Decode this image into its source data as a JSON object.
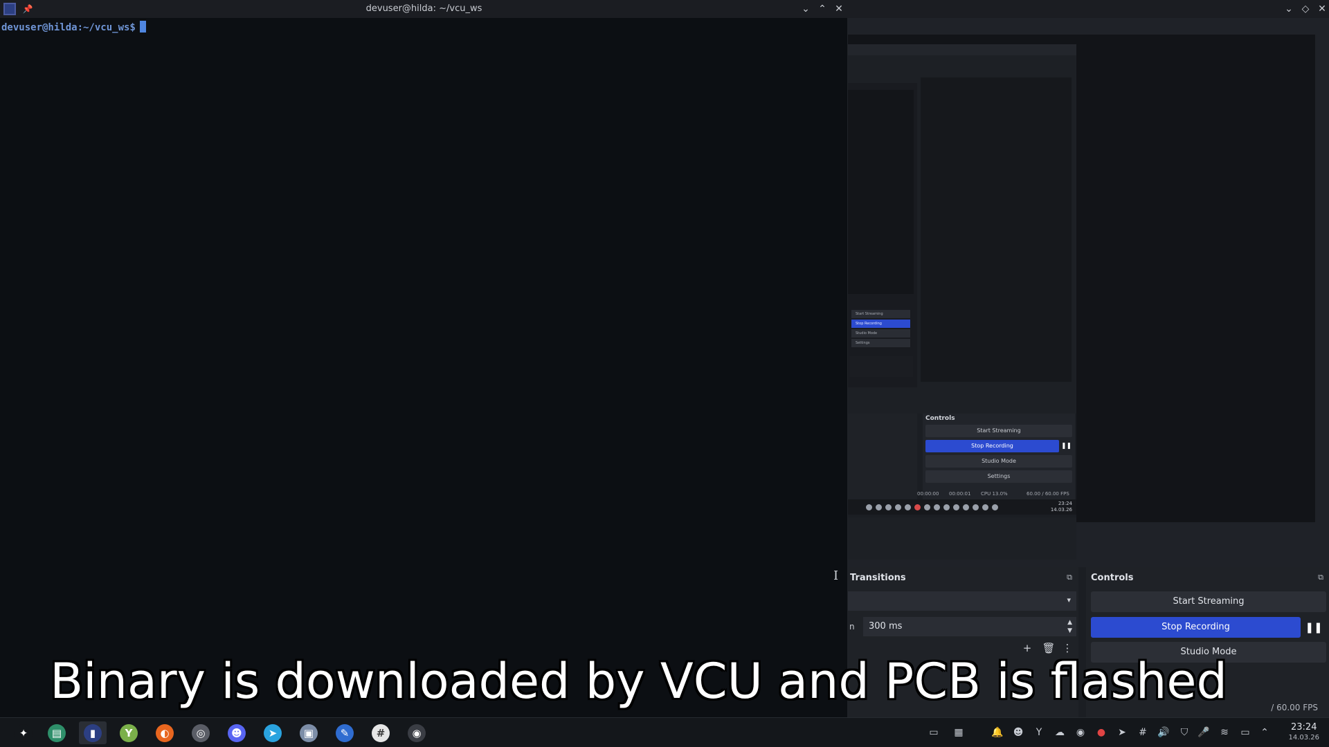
{
  "terminal": {
    "title": "devuser@hilda: ~/vcu_ws",
    "prompt": "devuser@hilda:~/vcu_ws$"
  },
  "obs": {
    "transitions": {
      "title": "Transitions",
      "duration_label": "n",
      "duration_value": "300 ms"
    },
    "controls": {
      "title": "Controls",
      "start_streaming": "Start Streaming",
      "stop_recording": "Stop Recording",
      "studio_mode": "Studio Mode"
    },
    "status_fps": "/ 60.00 FPS",
    "nested_preview": {
      "controls_title": "Controls",
      "start_streaming": "Start Streaming",
      "stop_recording": "Stop Recording",
      "studio_mode": "Studio Mode",
      "settings": "Settings",
      "status_time_1": "00:00:00",
      "status_time_2": "00:00:01",
      "status_cpu": "CPU 13.0%",
      "status_fps": "60.00 / 60.00 FPS",
      "clock_time": "23:24",
      "clock_date": "14.03.26",
      "inner_controls": [
        "Start Streaming",
        "Stop Recording",
        "Studio Mode",
        "Settings"
      ]
    }
  },
  "caption": "Binary is downloaded by VCU and PCB is flashed",
  "taskbar": {
    "apps": [
      {
        "name": "app-launcher-icon",
        "glyph": "✦",
        "color": "#14171b"
      },
      {
        "name": "file-manager-icon",
        "glyph": "▤",
        "color": "#2e8f6a"
      },
      {
        "name": "terminal-icon",
        "glyph": "▮",
        "color": "#2c3f82"
      },
      {
        "name": "yubikey-icon",
        "glyph": "Y",
        "color": "#7bb04a"
      },
      {
        "name": "firefox-icon",
        "glyph": "◐",
        "color": "#e8661f"
      },
      {
        "name": "tor-icon",
        "glyph": "◎",
        "color": "#5a5d66"
      },
      {
        "name": "discord-icon",
        "glyph": "☻",
        "color": "#5865f2"
      },
      {
        "name": "telegram-icon",
        "glyph": "➤",
        "color": "#2aa3df"
      },
      {
        "name": "screenshot-icon",
        "glyph": "▣",
        "color": "#7d8ea8"
      },
      {
        "name": "editor-icon",
        "glyph": "✎",
        "color": "#2f6cd0"
      },
      {
        "name": "slack-icon",
        "glyph": "#",
        "color": "#e6e6e6"
      },
      {
        "name": "obs-icon",
        "glyph": "◉",
        "color": "#3a3d44"
      }
    ],
    "clock_time": "23:24",
    "clock_date": "14.03.26"
  }
}
